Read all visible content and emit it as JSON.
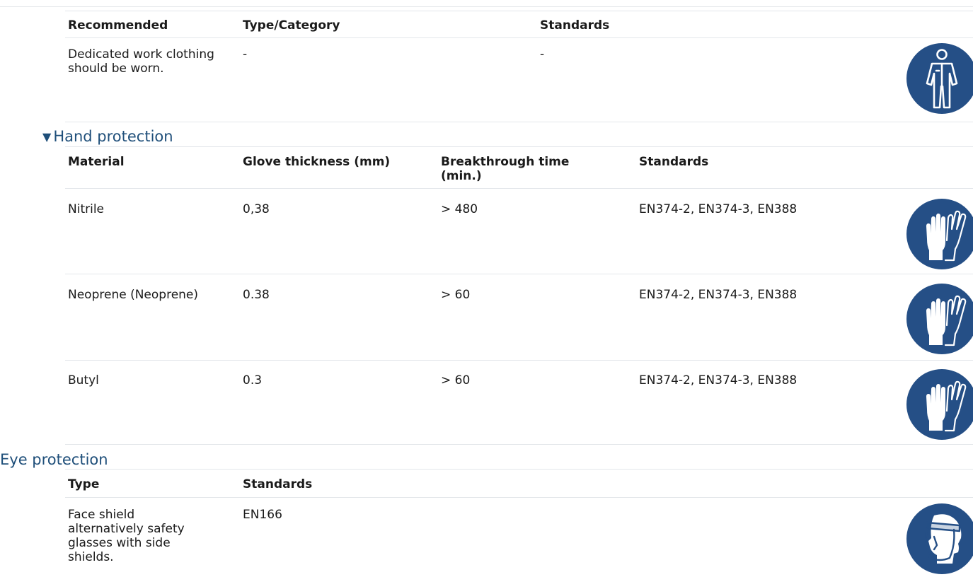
{
  "body_protection": {
    "headers": {
      "recommended": "Recommended",
      "type_category": "Type/Category",
      "standards": "Standards"
    },
    "row": {
      "recommended": "Dedicated work clothing should be worn.",
      "type_category": "-",
      "standards": "-"
    },
    "icon": "protective-clothing-icon",
    "icon_color": "#254f86"
  },
  "hand_protection": {
    "title": "Hand protection",
    "expanded": true,
    "headers": {
      "material": "Material",
      "thickness": "Glove thickness (mm)",
      "breakthrough": "Breakthrough time (min.)",
      "standards": "Standards"
    },
    "rows": [
      {
        "material": "Nitrile",
        "thickness": "0,38",
        "breakthrough": "> 480",
        "standards": "EN374-2, EN374-3, EN388"
      },
      {
        "material": "Neoprene (Neoprene)",
        "thickness": "0.38",
        "breakthrough": "> 60",
        "standards": "EN374-2, EN374-3, EN388"
      },
      {
        "material": "Butyl",
        "thickness": "0.3",
        "breakthrough": "> 60",
        "standards": "EN374-2, EN374-3, EN388"
      }
    ],
    "icon": "gloves-icon",
    "icon_color": "#254f86"
  },
  "eye_protection": {
    "title": "Eye protection",
    "headers": {
      "type": "Type",
      "standards": "Standards"
    },
    "row": {
      "type": "Face shield alternatively safety glasses with side shields.",
      "standards": "EN166"
    },
    "icon": "face-shield-icon",
    "icon_color": "#254f86"
  },
  "colors": {
    "section_title": "#1f4f7a",
    "divider": "#e3e6ea",
    "pictogram_blue": "#254f86"
  }
}
